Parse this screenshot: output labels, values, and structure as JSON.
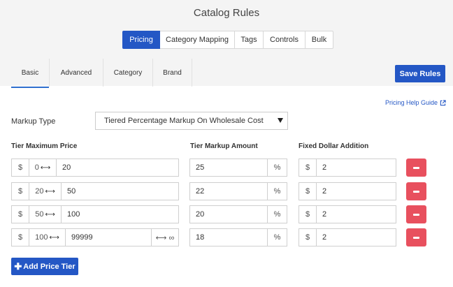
{
  "page": {
    "title": "Catalog Rules"
  },
  "main_tabs": [
    {
      "label": "Pricing",
      "active": true
    },
    {
      "label": "Category Mapping",
      "active": false
    },
    {
      "label": "Tags",
      "active": false
    },
    {
      "label": "Controls",
      "active": false
    },
    {
      "label": "Bulk",
      "active": false
    }
  ],
  "sub_tabs": [
    {
      "label": "Basic",
      "active": true
    },
    {
      "label": "Advanced",
      "active": false
    },
    {
      "label": "Category",
      "active": false
    },
    {
      "label": "Brand",
      "active": false
    }
  ],
  "actions": {
    "save_label": "Save Rules",
    "add_tier_label": "Add Price Tier",
    "help_link": "Pricing Help Guide"
  },
  "markup": {
    "label": "Markup Type",
    "selected": "Tiered Percentage Markup On Wholesale Cost"
  },
  "columns": {
    "tier_max": "Tier Maximum Price",
    "markup_amount": "Tier Markup Amount",
    "fixed_addition": "Fixed Dollar Addition"
  },
  "symbols": {
    "dollar": "$",
    "percent": "%",
    "arrow": "⟷",
    "infinity": "⟷ ∞"
  },
  "tiers": [
    {
      "min": "0",
      "max": "20",
      "markup": "25",
      "fixed": "2"
    },
    {
      "min": "20",
      "max": "50",
      "markup": "22",
      "fixed": "2"
    },
    {
      "min": "50",
      "max": "100",
      "markup": "20",
      "fixed": "2"
    },
    {
      "min": "100",
      "max": "99999",
      "markup": "18",
      "fixed": "2"
    }
  ],
  "colors": {
    "primary": "#2457c5",
    "danger": "#e8505e",
    "header_bg": "#f4f4f4"
  }
}
